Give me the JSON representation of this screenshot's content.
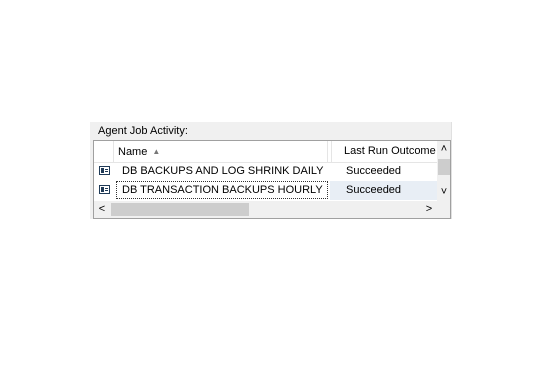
{
  "panel": {
    "label": "Agent Job Activity:"
  },
  "columns": {
    "name": "Name",
    "name_sort_icon": "sort-ascending-icon",
    "outcome": "Last Run Outcome"
  },
  "rows": [
    {
      "name": "DB BACKUPS AND LOG SHRINK DAILY",
      "outcome": "Succeeded",
      "icon": "job-icon",
      "selected": false
    },
    {
      "name": "DB TRANSACTION BACKUPS HOURLY",
      "outcome": "Succeeded",
      "icon": "job-icon",
      "selected": true
    }
  ],
  "scrollbars": {
    "up": "˄",
    "down": "˅",
    "left": "<",
    "right": ">"
  },
  "colors": {
    "selection": "#e8eef5",
    "scroll_thumb": "#cdcdcd"
  }
}
